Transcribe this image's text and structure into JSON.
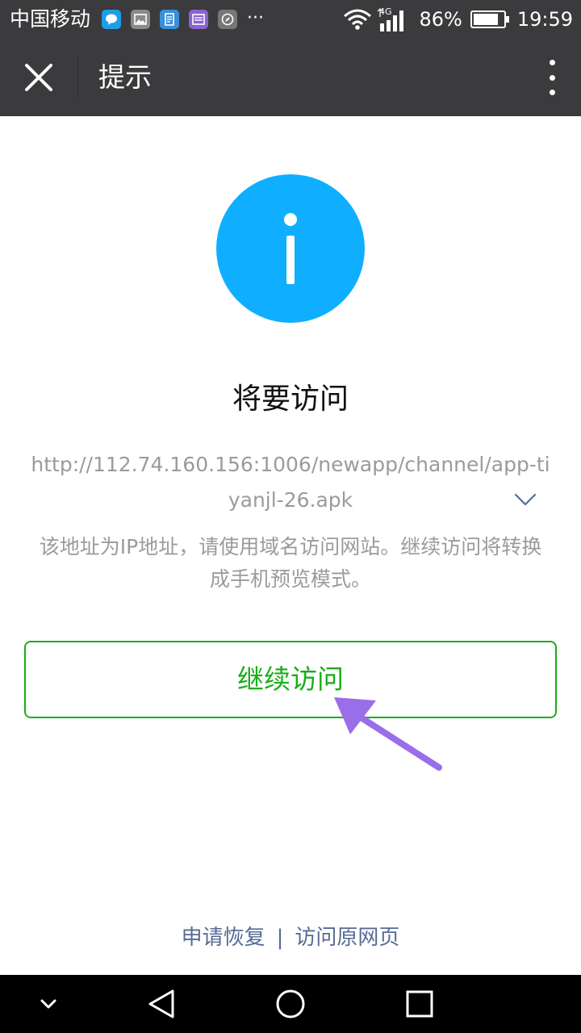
{
  "status_bar": {
    "carrier": "中国移动",
    "notification_icons": [
      {
        "icon": "chat-bubble-icon",
        "color": "#1e9ee8"
      },
      {
        "icon": "image-icon",
        "color": "#8a8a8a"
      },
      {
        "icon": "document-icon",
        "color": "#3a8fd9"
      },
      {
        "icon": "message-icon",
        "color": "#8a63d2"
      },
      {
        "icon": "compass-icon",
        "color": "#777777"
      }
    ],
    "more_notifications": "···",
    "network": "4G",
    "battery_percent": "86%",
    "battery_level": 0.86,
    "time": "19:59"
  },
  "title_bar": {
    "title": "提示",
    "close_icon": "close-icon",
    "more_icon": "more-vertical-icon"
  },
  "content": {
    "icon": "info-icon",
    "icon_color": "#10aeff",
    "heading": "将要访问",
    "url": "http://112.74.160.156:1006/newapp/channel/app-tiyanjl-26.apk",
    "expand_icon": "chevron-down-icon",
    "notice": "该地址为IP地址，请使用域名访问网站。继续访问将转换成手机预览模式。",
    "continue_button": "继续访问",
    "accent_color": "#1aad19",
    "annotation_color": "#9a6ee8"
  },
  "footer": {
    "request_restore": "申请恢复",
    "separator": "|",
    "visit_original": "访问原网页",
    "link_color": "#576b95"
  },
  "nav_bar": {
    "buttons": [
      "chevron-down-icon",
      "back-triangle-icon",
      "home-circle-icon",
      "recents-square-icon"
    ]
  }
}
